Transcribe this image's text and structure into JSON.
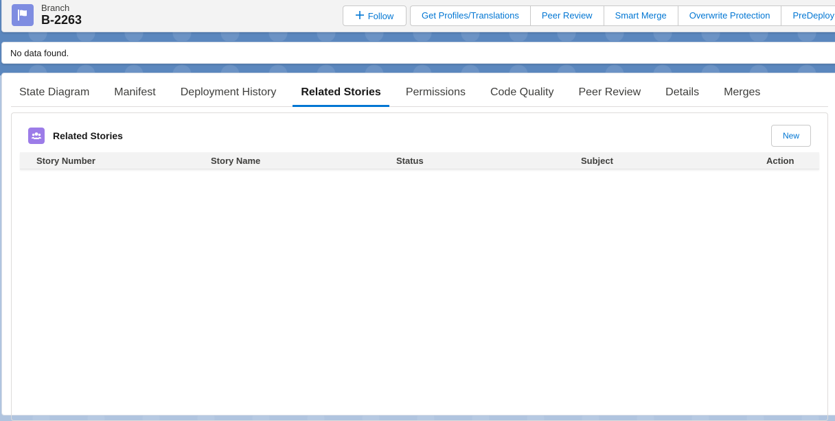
{
  "header": {
    "object_label": "Branch",
    "record_title": "B-2263",
    "follow_label": "Follow",
    "actions": [
      "Get Profiles/Translations",
      "Peer Review",
      "Smart Merge",
      "Overwrite Protection",
      "PreDeploy"
    ]
  },
  "message": {
    "text": "No data found."
  },
  "tabs": {
    "items": [
      "State Diagram",
      "Manifest",
      "Deployment History",
      "Related Stories",
      "Permissions",
      "Code Quality",
      "Peer Review",
      "Details",
      "Merges"
    ],
    "active": "Related Stories"
  },
  "related_stories": {
    "title": "Related Stories",
    "new_label": "New",
    "columns": [
      "Story Number",
      "Story Name",
      "Status",
      "Subject",
      "Action"
    ]
  },
  "colors": {
    "brand": "#0176d3",
    "branch_icon": "#7f8de1",
    "stories_icon": "#9c7ce8"
  },
  "icons": {
    "branch": "flag-icon",
    "follow": "plus-icon",
    "stories": "people-icon"
  }
}
